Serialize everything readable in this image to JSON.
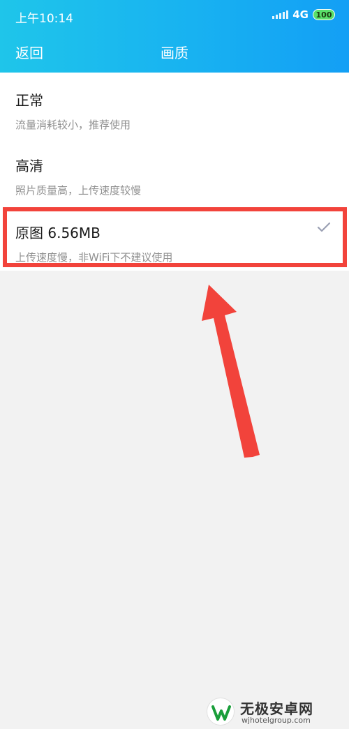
{
  "status_bar": {
    "time": "上午10:14",
    "network": "4G",
    "battery": "100"
  },
  "nav": {
    "back_label": "返回",
    "title": "画质"
  },
  "options": [
    {
      "title": "正常",
      "desc": "流量消耗较小，推荐使用",
      "selected": false
    },
    {
      "title": "高清",
      "desc": "照片质量高，上传速度较慢",
      "selected": false
    },
    {
      "title": "原图  6.56MB",
      "desc": "上传速度慢，非WiFi下不建议使用",
      "selected": true
    }
  ],
  "colors": {
    "header_start": "#1fc5ea",
    "header_end": "#139ff5",
    "annotation_red": "#f2433b",
    "check_gray": "#9a9fb3"
  },
  "watermark": {
    "name": "无极安卓网",
    "url": "wjhotelgroup.com"
  }
}
